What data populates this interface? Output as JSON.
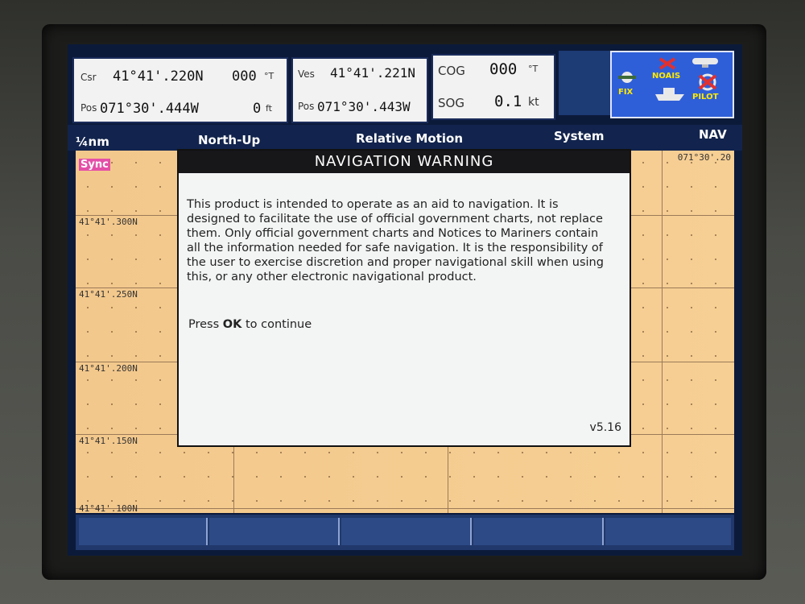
{
  "panels": {
    "csr_label": "Csr",
    "csr_lat": "41°41'.220N",
    "csr_bearing": "000",
    "csr_bearing_unit": "°T",
    "pos_label": "Pos",
    "pos_lon": "071°30'.444W",
    "pos_depth": "0",
    "pos_depth_unit": "ft",
    "ves_label": "Ves",
    "ves_lat": "41°41'.221N",
    "ves_pos_label": "Pos",
    "ves_lon": "071°30'.443W",
    "cog_label": "COG",
    "cog_value": "000",
    "cog_unit": "°T",
    "sog_label": "SOG",
    "sog_value": "0.1",
    "sog_unit": "kt"
  },
  "status": {
    "fix": "FIX",
    "noais": "NOAIS",
    "pilot": "PILOT"
  },
  "menubar": {
    "scale": "¼nm",
    "orientation": "North-Up",
    "motion": "Relative Motion",
    "system": "System",
    "nav": "NAV"
  },
  "chart": {
    "sync": "Sync",
    "lon_label": "071°30'.20",
    "lat_labels": [
      "41°41'.300N",
      "41°41'.250N",
      "41°41'.200N",
      "41°41'.150N",
      "41°41'.100N"
    ]
  },
  "dialog": {
    "title": "NAVIGATION WARNING",
    "body": "This product is intended to operate as an aid to navigation. It is designed to facilitate the use of official government charts, not replace them.  Only official government charts and Notices to Mariners contain all the information needed for safe navigation. It is the responsibility of the user to exercise discretion and proper navigational skill when using this, or any other electronic navigational product.",
    "press_prefix": "Press ",
    "press_key": "OK",
    "press_suffix": " to continue",
    "version": "v5.16"
  },
  "colors": {
    "menubar": "#12244d",
    "chart": "#f4c78a",
    "status_box": "#2f5fd8",
    "sync_badge": "#e44fa8"
  }
}
